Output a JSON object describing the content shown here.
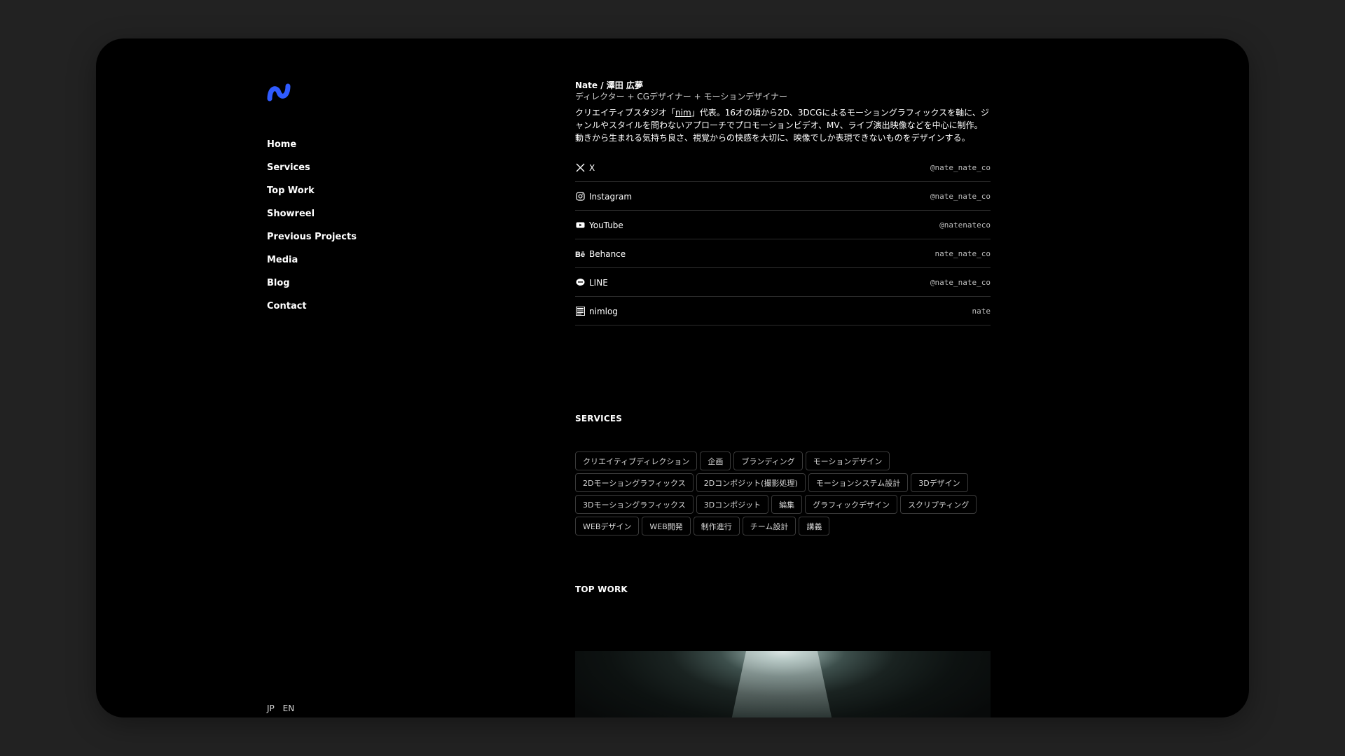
{
  "nav": {
    "items": [
      "Home",
      "Services",
      "Top Work",
      "Showreel",
      "Previous Projects",
      "Media",
      "Blog",
      "Contact"
    ]
  },
  "language": {
    "jp": "JP",
    "en": "EN"
  },
  "profile": {
    "name": "Nate / 澤田 広夢",
    "role": "ディレクター + CGデザイナー + モーションデザイナー",
    "bio_prefix": "クリエイティブスタジオ「",
    "bio_link": "nim",
    "bio_suffix": "」代表。16才の頃から2D、3DCGによるモーショングラフィックスを軸に、ジャンルやスタイルを問わないアプローチでプロモーションビデオ、MV、ライブ演出映像などを中心に制作。動きから生まれる気持ち良さ、視覚からの快感を大切に、映像でしか表現できないものをデザインする。"
  },
  "social": [
    {
      "name": "X",
      "handle": "@nate_nate_co",
      "icon": "x-icon"
    },
    {
      "name": "Instagram",
      "handle": "@nate_nate_co",
      "icon": "instagram-icon"
    },
    {
      "name": "YouTube",
      "handle": "@natenateco",
      "icon": "youtube-icon"
    },
    {
      "name": "Behance",
      "handle": "nate_nate_co",
      "icon": "behance-icon"
    },
    {
      "name": "LINE",
      "handle": "@nate_nate_co",
      "icon": "line-icon"
    },
    {
      "name": "nimlog",
      "handle": "nate",
      "icon": "nimlog-icon"
    }
  ],
  "services": {
    "title": "SERVICES",
    "tags": [
      "クリエイティブディレクション",
      "企画",
      "ブランディング",
      "モーションデザイン",
      "2Dモーショングラフィックス",
      "2Dコンポジット(撮影処理)",
      "モーションシステム設計",
      "3Dデザイン",
      "3Dモーショングラフィックス",
      "3Dコンポジット",
      "編集",
      "グラフィックデザイン",
      "スクリプティング",
      "WEBデザイン",
      "WEB開発",
      "制作進行",
      "チーム設計",
      "講義"
    ]
  },
  "top_work": {
    "title": "TOP WORK"
  },
  "colors": {
    "accent": "#2f5bff",
    "background": "#222222",
    "panel": "#000000"
  }
}
